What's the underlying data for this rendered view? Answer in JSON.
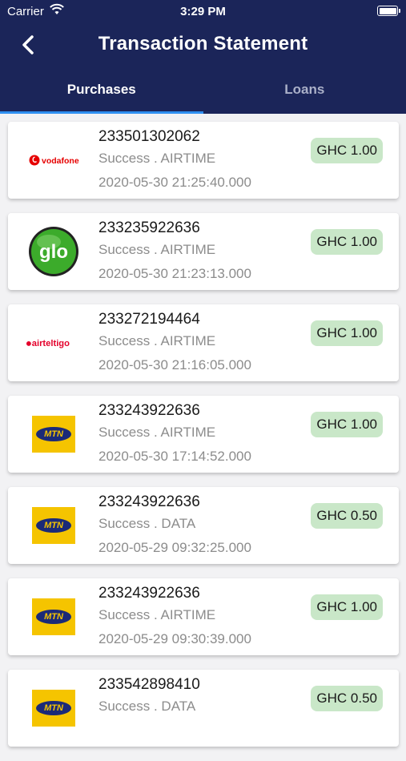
{
  "status_bar": {
    "carrier": "Carrier",
    "time": "3:29 PM"
  },
  "header": {
    "title": "Transaction Statement"
  },
  "tabs": [
    {
      "label": "Purchases",
      "active": true
    },
    {
      "label": "Loans",
      "active": false
    }
  ],
  "transactions": [
    {
      "provider": "vodafone",
      "logo_text": "vodafone",
      "phone": "233501302062",
      "status": "Success . AIRTIME",
      "date": "2020-05-30 21:25:40.000",
      "amount": "GHC 1.00"
    },
    {
      "provider": "glo",
      "logo_text": "glo",
      "phone": "233235922636",
      "status": "Success . AIRTIME",
      "date": "2020-05-30 21:23:13.000",
      "amount": "GHC 1.00"
    },
    {
      "provider": "airteltigo",
      "logo_text": "airteltigo",
      "phone": "233272194464",
      "status": "Success . AIRTIME",
      "date": "2020-05-30 21:16:05.000",
      "amount": "GHC 1.00"
    },
    {
      "provider": "mtn",
      "logo_text": "MTN",
      "phone": "233243922636",
      "status": "Success . AIRTIME",
      "date": "2020-05-30 17:14:52.000",
      "amount": "GHC 1.00"
    },
    {
      "provider": "mtn",
      "logo_text": "MTN",
      "phone": "233243922636",
      "status": "Success . DATA",
      "date": "2020-05-29 09:32:25.000",
      "amount": "GHC 0.50"
    },
    {
      "provider": "mtn",
      "logo_text": "MTN",
      "phone": "233243922636",
      "status": "Success . AIRTIME",
      "date": "2020-05-29 09:30:39.000",
      "amount": "GHC 1.00"
    },
    {
      "provider": "mtn",
      "logo_text": "MTN",
      "phone": "233542898410",
      "status": "Success . DATA",
      "date": "",
      "amount": "GHC 0.50"
    }
  ],
  "colors": {
    "header_bg": "#1b2559",
    "tab_indicator": "#2f8ff0",
    "amount_badge": "#c9e7c8"
  }
}
